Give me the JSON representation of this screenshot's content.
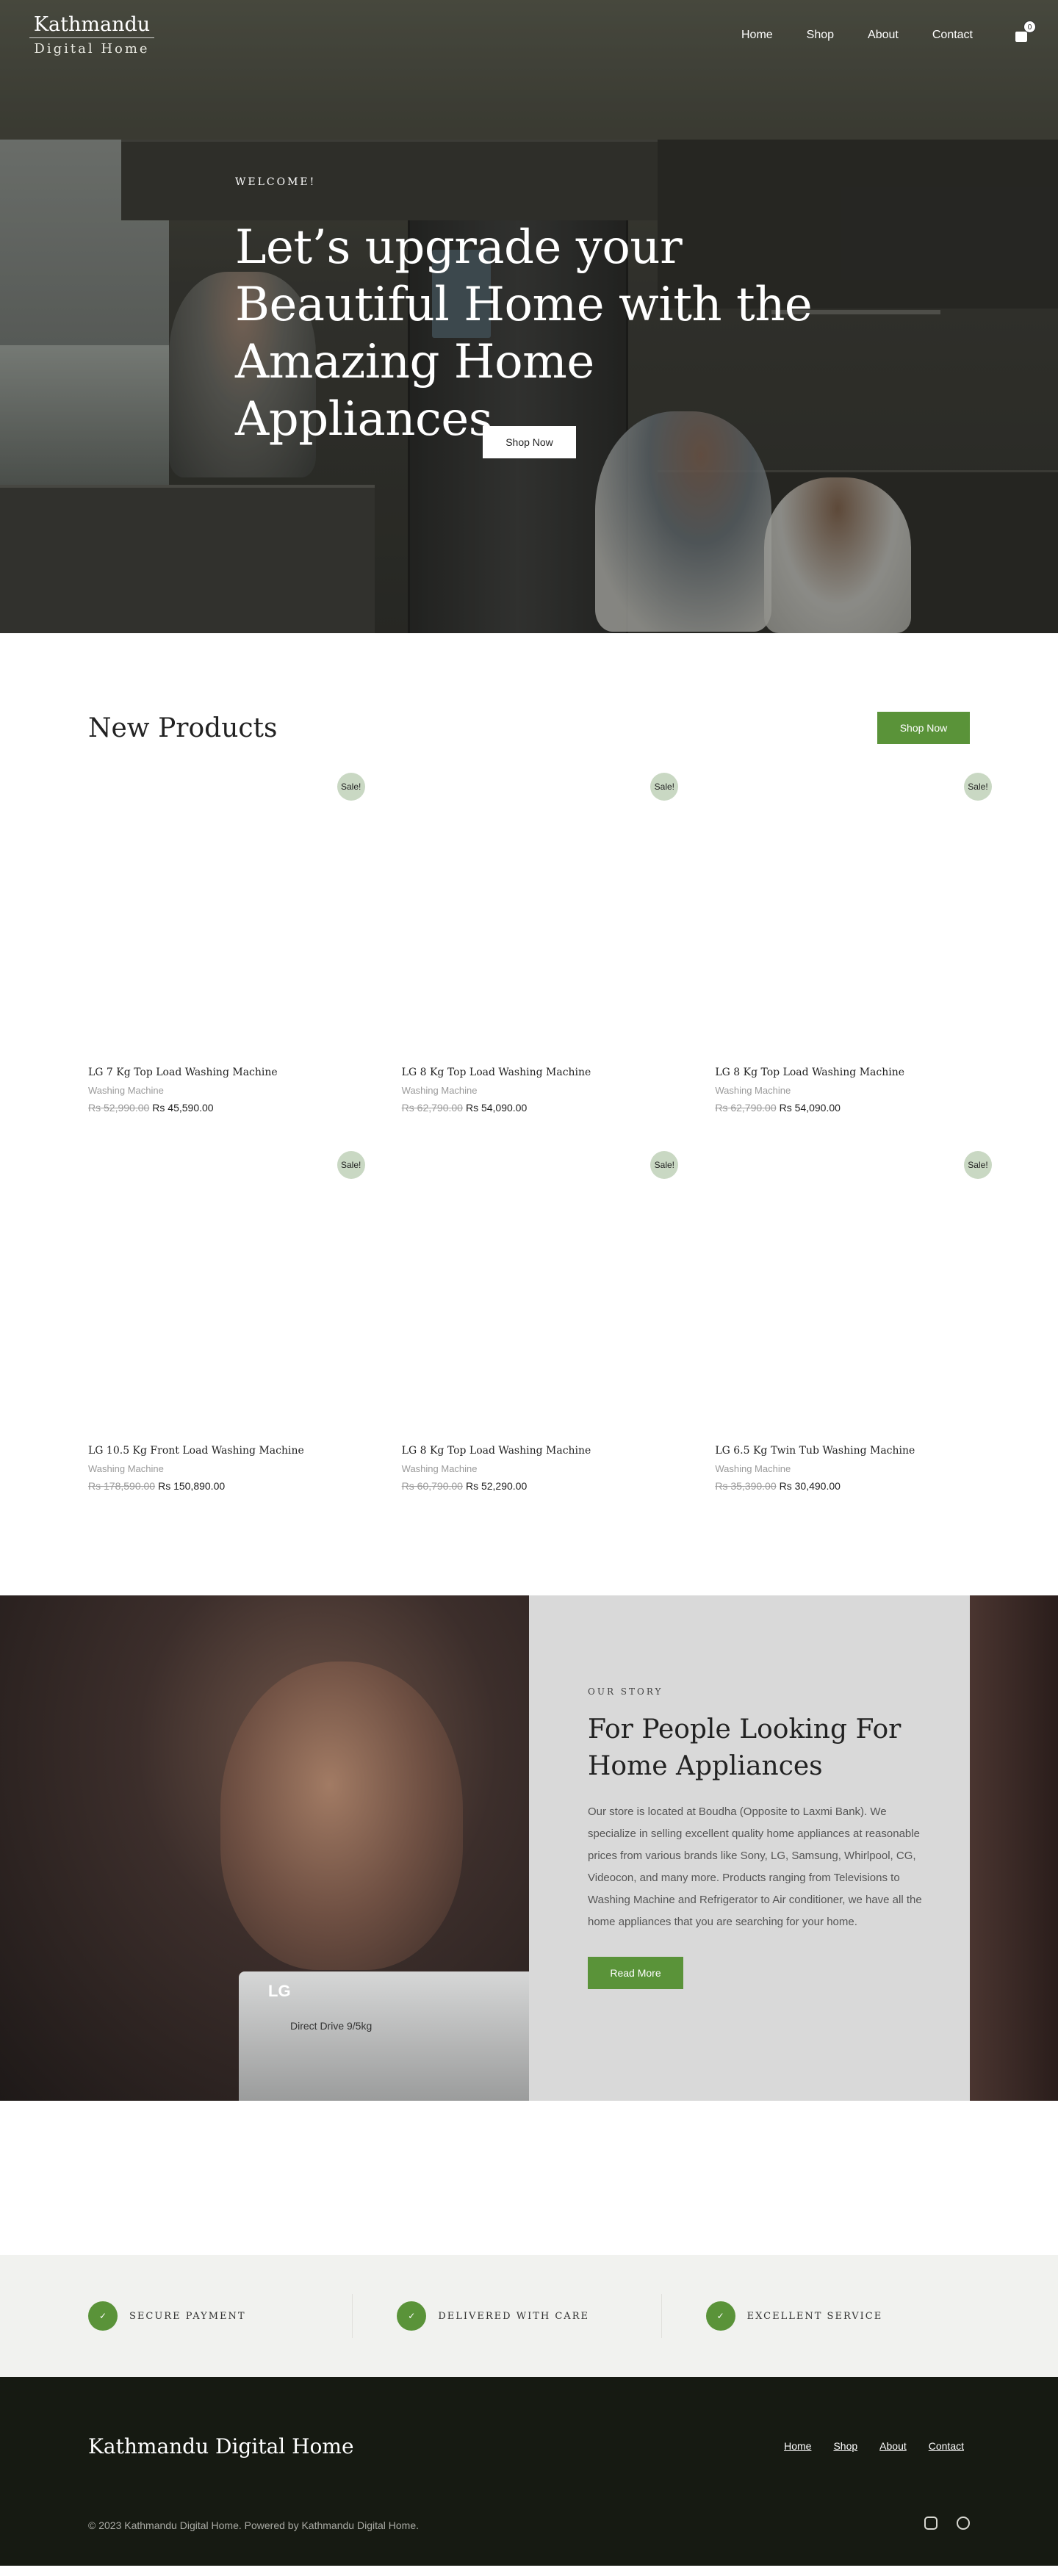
{
  "header": {
    "logo_line1": "Kathmandu",
    "logo_line2": "Digital Home",
    "nav": [
      "Home",
      "Shop",
      "About",
      "Contact"
    ],
    "cart_count": "0"
  },
  "hero": {
    "kicker": "WELCOME!",
    "title": "Let’s upgrade your Beautiful Home with the Amazing Home Appliances.",
    "button": "Shop Now"
  },
  "products": {
    "title": "New Products",
    "button": "Shop Now",
    "sale_badge": "Sale!",
    "items": [
      {
        "title": "LG 7 Kg Top Load Washing Machine",
        "category": "Washing Machine",
        "old_price": "Rs 52,990.00",
        "price": "Rs 45,590.00"
      },
      {
        "title": "LG 8 Kg Top Load Washing Machine",
        "category": "Washing Machine",
        "old_price": "Rs 62,790.00",
        "price": "Rs 54,090.00"
      },
      {
        "title": "LG 8 Kg Top Load Washing Machine",
        "category": "Washing Machine",
        "old_price": "Rs 62,790.00",
        "price": "Rs 54,090.00"
      },
      {
        "title": "LG 10.5 Kg Front Load Washing Machine",
        "category": "Washing Machine",
        "old_price": "Rs 178,590.00",
        "price": "Rs 150,890.00"
      },
      {
        "title": "LG 8 Kg Top Load Washing Machine",
        "category": "Washing Machine",
        "old_price": "Rs 60,790.00",
        "price": "Rs 52,290.00"
      },
      {
        "title": "LG 6.5 Kg Twin Tub Washing Machine",
        "category": "Washing Machine",
        "old_price": "Rs 35,390.00",
        "price": "Rs 30,490.00"
      }
    ]
  },
  "story": {
    "kicker": "OUR STORY",
    "title": "For People Looking For Home Appliances",
    "body": "Our store is located at Boudha (Opposite to Laxmi Bank). We specialize in selling excellent quality home appliances at reasonable prices from various brands like Sony, LG, Samsung, Whirlpool, CG, Videocon, and many more. Products ranging from Televisions to Washing Machine and Refrigerator to Air conditioner, we have all the home appliances that you are searching for your home.",
    "button": "Read More",
    "washer_brand": "LG",
    "washer_text": "Direct Drive  9/5kg"
  },
  "features": [
    {
      "label": "SECURE PAYMENT"
    },
    {
      "label": "DELIVERED WITH CARE"
    },
    {
      "label": "EXCELLENT SERVICE"
    }
  ],
  "footer": {
    "brand": "Kathmandu Digital Home",
    "links": [
      "Home",
      "Shop",
      "About",
      "Contact"
    ],
    "copyright": "© 2023 Kathmandu Digital Home. Powered by Kathmandu Digital Home.",
    "social": [
      "instagram-icon",
      "facebook-icon"
    ]
  },
  "colors": {
    "accent": "#5a9339",
    "footer_bg": "#161a12",
    "features_bg": "#f1f2ef",
    "sale_badge": "#c9d8c3"
  }
}
